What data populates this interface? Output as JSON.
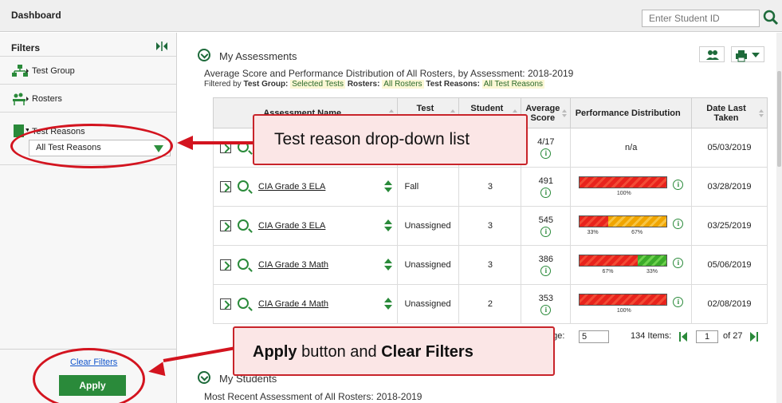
{
  "header": {
    "title": "Dashboard",
    "student_id_placeholder": "Enter Student ID"
  },
  "sidebar": {
    "title": "Filters",
    "items": [
      {
        "label": "Test Group"
      },
      {
        "label": "Rosters"
      },
      {
        "label": "Test Reasons"
      }
    ],
    "reason_select_value": "All Test Reasons",
    "clear_filters": "Clear Filters",
    "apply": "Apply"
  },
  "assessments": {
    "title": "My Assessments",
    "subtitle": "Average Score and Performance Distribution of All Rosters, by Assessment: 2018-2019",
    "filtered_by": "Filtered by",
    "filters": [
      {
        "label": "Test Group:",
        "value": "Selected Tests"
      },
      {
        "label": "Rosters:",
        "value": "All Rosters"
      },
      {
        "label": "Test Reasons:",
        "value": "All Test Reasons"
      }
    ],
    "columns": [
      "Assessment Name",
      "Test Reason",
      "Student Count",
      "Average Score",
      "Performance Distribution",
      "Date Last Taken"
    ],
    "rows": [
      {
        "name": "",
        "reason": "",
        "count": "",
        "score": "4/17",
        "perf_text": "n/a",
        "date": "05/03/2019"
      },
      {
        "name": "CIA Grade 3 ELA",
        "reason": "Fall",
        "count": "3",
        "score": "491",
        "date": "03/28/2019",
        "distribution": [
          {
            "level": "red",
            "pct": 100,
            "label": "100%"
          }
        ]
      },
      {
        "name": "CIA Grade 3 ELA",
        "reason": "Unassigned",
        "count": "3",
        "score": "545",
        "date": "03/25/2019",
        "distribution": [
          {
            "level": "red",
            "pct": 33,
            "label": "33%"
          },
          {
            "level": "orange",
            "pct": 67,
            "label": "67%"
          }
        ]
      },
      {
        "name": "CIA Grade 3 Math",
        "reason": "Unassigned",
        "count": "3",
        "score": "386",
        "date": "05/06/2019",
        "distribution": [
          {
            "level": "red",
            "pct": 67,
            "label": "67%"
          },
          {
            "level": "green",
            "pct": 33,
            "label": "33%"
          }
        ]
      },
      {
        "name": "CIA Grade 4 Math",
        "reason": "Unassigned",
        "count": "2",
        "score": "353",
        "date": "02/08/2019",
        "distribution": [
          {
            "level": "red",
            "pct": 100,
            "label": "100%"
          }
        ]
      }
    ],
    "pagination": {
      "page_size_label_fragment": "age:",
      "page_size": "5",
      "items_label": "134 Items:",
      "page": "1",
      "of_label": "of 27"
    }
  },
  "students": {
    "title": "My Students",
    "subtitle": "Most Recent Assessment of All Rosters: 2018-2019"
  },
  "callouts": {
    "reason_dropdown": "Test reason drop-down list",
    "apply_bold": "Apply",
    "apply_mid": " button and ",
    "clear_bold": "Clear Filters"
  },
  "colors": {
    "accent_green": "#2a8a3a",
    "callout_border": "#c8242a",
    "callout_bg": "#fbe6e6",
    "level_red": "#e8231c",
    "level_orange": "#f0a500",
    "level_green": "#3cab2a"
  }
}
